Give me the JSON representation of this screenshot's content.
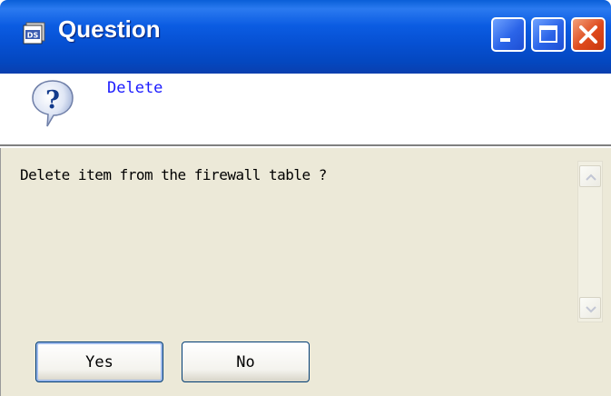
{
  "window": {
    "title": "Question",
    "app_icon": "ds-app-icon",
    "controls": {
      "minimize": "minimize-icon",
      "maximize": "maximize-icon",
      "close": "close-icon"
    }
  },
  "header": {
    "icon": "question-icon",
    "label": "Delete"
  },
  "body": {
    "message": "Delete item from the firewall table ?"
  },
  "buttons": {
    "yes": "Yes",
    "no": "No"
  },
  "colors": {
    "title_bar": "#0650d2",
    "header_label": "#1a1aff",
    "content_bg": "#ece9d8",
    "close_button": "#de4a1c"
  }
}
